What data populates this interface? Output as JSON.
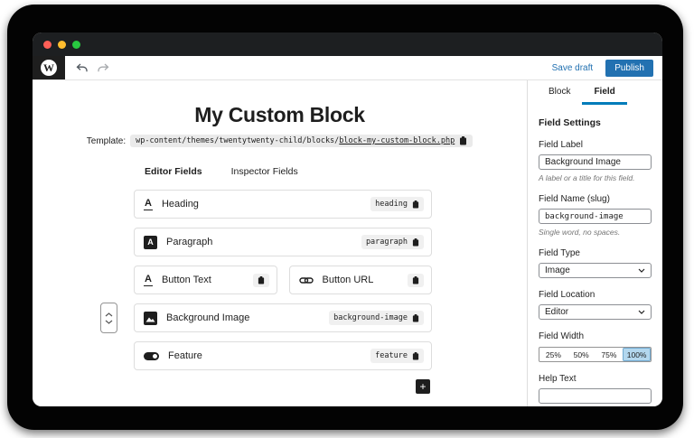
{
  "toolbar": {
    "save_draft": "Save draft",
    "publish": "Publish"
  },
  "editor": {
    "title": "My Custom Block",
    "template": {
      "label": "Template:",
      "path": "wp-content/themes/twentytwenty-child/blocks/",
      "file": "block-my-custom-block.php"
    },
    "tabs": {
      "editor": "Editor Fields",
      "inspector": "Inspector Fields"
    },
    "fields": {
      "heading": {
        "label": "Heading",
        "slug": "heading"
      },
      "paragraph": {
        "label": "Paragraph",
        "slug": "paragraph"
      },
      "button_text": {
        "label": "Button Text"
      },
      "button_url": {
        "label": "Button URL"
      },
      "background_image": {
        "label": "Background Image",
        "slug": "background-image"
      },
      "feature": {
        "label": "Feature",
        "slug": "feature"
      }
    },
    "add_button": "+"
  },
  "sidebar": {
    "tabs": {
      "block": "Block",
      "field": "Field"
    },
    "heading": "Field Settings",
    "field_label": {
      "label": "Field Label",
      "value": "Background Image",
      "help": "A label or a title for this field."
    },
    "field_name": {
      "label": "Field Name (slug)",
      "value": "background-image",
      "help": "Single word, no spaces."
    },
    "field_type": {
      "label": "Field Type",
      "value": "Image"
    },
    "field_location": {
      "label": "Field Location",
      "value": "Editor"
    },
    "field_width": {
      "label": "Field Width",
      "options": [
        "25%",
        "50%",
        "75%",
        "100%"
      ],
      "selected": "100%"
    },
    "help_text": {
      "label": "Help Text",
      "value": ""
    }
  },
  "icons": {
    "heading": "text-underline-icon",
    "paragraph": "paragraph-icon",
    "button_text": "text-underline-icon",
    "button_url": "link-icon",
    "background_image": "image-icon",
    "feature": "toggle-icon",
    "copy": "copy-icon",
    "add": "plus-icon",
    "move": "up-down-chevrons-icon",
    "logo": "wordpress-icon"
  },
  "colors": {
    "accent": "#2271b1",
    "tab_underline": "#007cba",
    "selected_segment": "#b3d7ee",
    "titlebar": "#1d1f21",
    "traffic_red": "#ff5f57",
    "traffic_yellow": "#febc2e",
    "traffic_green": "#28c840"
  }
}
